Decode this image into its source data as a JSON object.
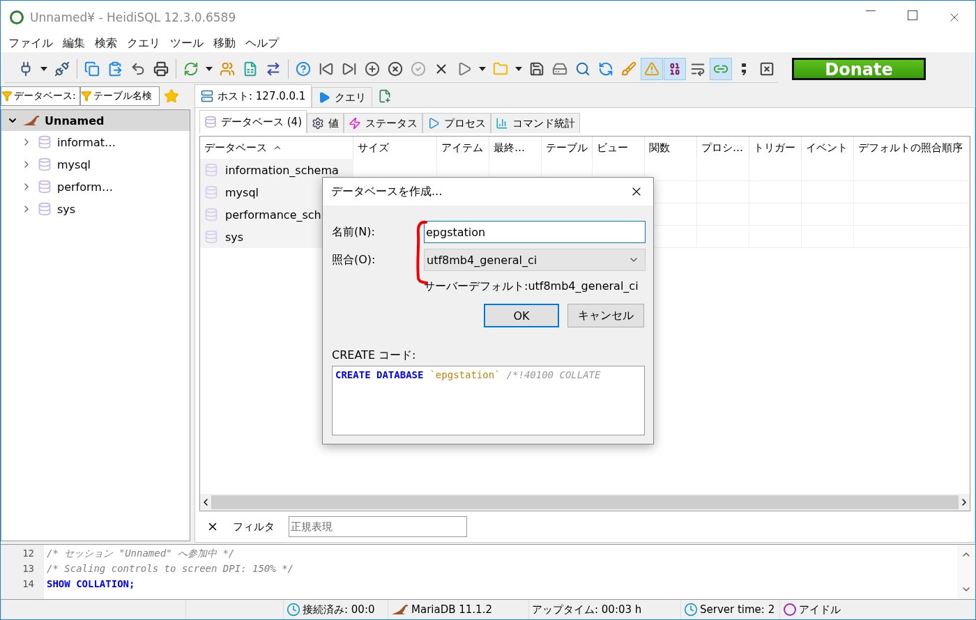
{
  "window": {
    "title": "Unnamed¥ - HeidiSQL 12.3.0.6589"
  },
  "menu": [
    "ファイル",
    "編集",
    "検索",
    "クエリ",
    "ツール",
    "移動",
    "ヘルプ"
  ],
  "toolbar": [
    {
      "pressed": false
    },
    {
      "pressed": false
    },
    {
      "pressed": false
    },
    {
      "pressed": false
    },
    {
      "pressed": false
    },
    {
      "pressed": false
    },
    {
      "pressed": false
    },
    {
      "pressed": false
    },
    {
      "pressed": false
    },
    {
      "pressed": false
    },
    {
      "pressed": false
    },
    {
      "pressed": false
    },
    {
      "pressed": false
    },
    {
      "pressed": false
    },
    {
      "pressed": false
    },
    {
      "pressed": false
    },
    {
      "pressed": false
    },
    {
      "pressed": false
    },
    {
      "pressed": false
    },
    {
      "pressed": false
    },
    {
      "pressed": false
    },
    {
      "pressed": false
    },
    {
      "pressed": false
    },
    {
      "pressed": false
    },
    {
      "pressed": false
    },
    {
      "pressed": false
    },
    {
      "pressed": false
    },
    {
      "pressed": false
    },
    {
      "pressed": true
    },
    {
      "pressed": true
    },
    {
      "pressed": false
    },
    {
      "pressed": true
    },
    {
      "pressed": false
    },
    {
      "pressed": false
    }
  ],
  "donate": "Donate",
  "filter_tabs": [
    "データベース:",
    "テーブル名検"
  ],
  "tree": {
    "label": "Unnamed",
    "expanded": true,
    "selected": true,
    "children": [
      {
        "label": "informat…",
        "expanded": false,
        "selected": false
      },
      {
        "label": "mysql",
        "expanded": false,
        "selected": false
      },
      {
        "label": "perform…",
        "expanded": false,
        "selected": false
      },
      {
        "label": "sys",
        "expanded": false,
        "selected": false
      }
    ]
  },
  "tabs": [
    {
      "label": "ホスト: 127.0.0.1",
      "selected": true
    },
    {
      "label": "クエリ",
      "selected": false
    }
  ],
  "subtabs": [
    {
      "label": "データベース (4)",
      "selected": true
    },
    {
      "label": "値",
      "selected": false
    },
    {
      "label": "ステータス",
      "selected": false
    },
    {
      "label": "プロセス",
      "selected": false
    },
    {
      "label": "コマンド統計",
      "selected": false
    }
  ],
  "table": {
    "columns": [
      {
        "label": "データベース",
        "sorted": true
      },
      {
        "label": "サイズ",
        "sorted": false
      },
      {
        "label": "アイテム",
        "sorted": false
      },
      {
        "label": "最終…",
        "sorted": false
      },
      {
        "label": "テーブル",
        "sorted": false
      },
      {
        "label": "ビュー",
        "sorted": false
      },
      {
        "label": "関数",
        "sorted": false
      },
      {
        "label": "プロシ…",
        "sorted": false
      },
      {
        "label": "トリガー",
        "sorted": false
      },
      {
        "label": "イベント",
        "sorted": false
      },
      {
        "label": "デフォルトの照合順序",
        "sorted": false
      }
    ],
    "rows": [
      "information_schema",
      "mysql",
      "performance_sch",
      "sys"
    ]
  },
  "filter": {
    "label": "フィルタ",
    "placeholder": "正規表現"
  },
  "log": [
    {
      "number": "12",
      "text": "/* セッション \"Unnamed\" へ参加中 */",
      "kind": "comment"
    },
    {
      "number": "13",
      "text": "/* Scaling controls to screen DPI: 150% */",
      "kind": "comment"
    },
    {
      "number": "14",
      "text": "SHOW COLLATION;",
      "kind": "statement"
    }
  ],
  "status_bar": [
    "接続済み: 00:0",
    "MariaDB 11.1.2",
    "アップタイム: 00:03 h",
    "Server time: 2",
    "アイドル"
  ],
  "dialog": {
    "title": "データベースを作成...",
    "name_label": "名前(N):",
    "name_value": "epgstation",
    "collation_label": "照合(O):",
    "collation_value": "utf8mb4_general_ci",
    "server_default": "サーバーデフォルト:utf8mb4_general_ci",
    "ok": "OK",
    "cancel": "キャンセル",
    "code_label": "CREATE コード:",
    "code": [
      {
        "text": "CREATE DATABASE",
        "kind": "keyword"
      },
      {
        "text": "`epgstation`",
        "kind": "identifier"
      },
      {
        "text": "/*!40100 COLLATE",
        "kind": "comment"
      }
    ]
  }
}
